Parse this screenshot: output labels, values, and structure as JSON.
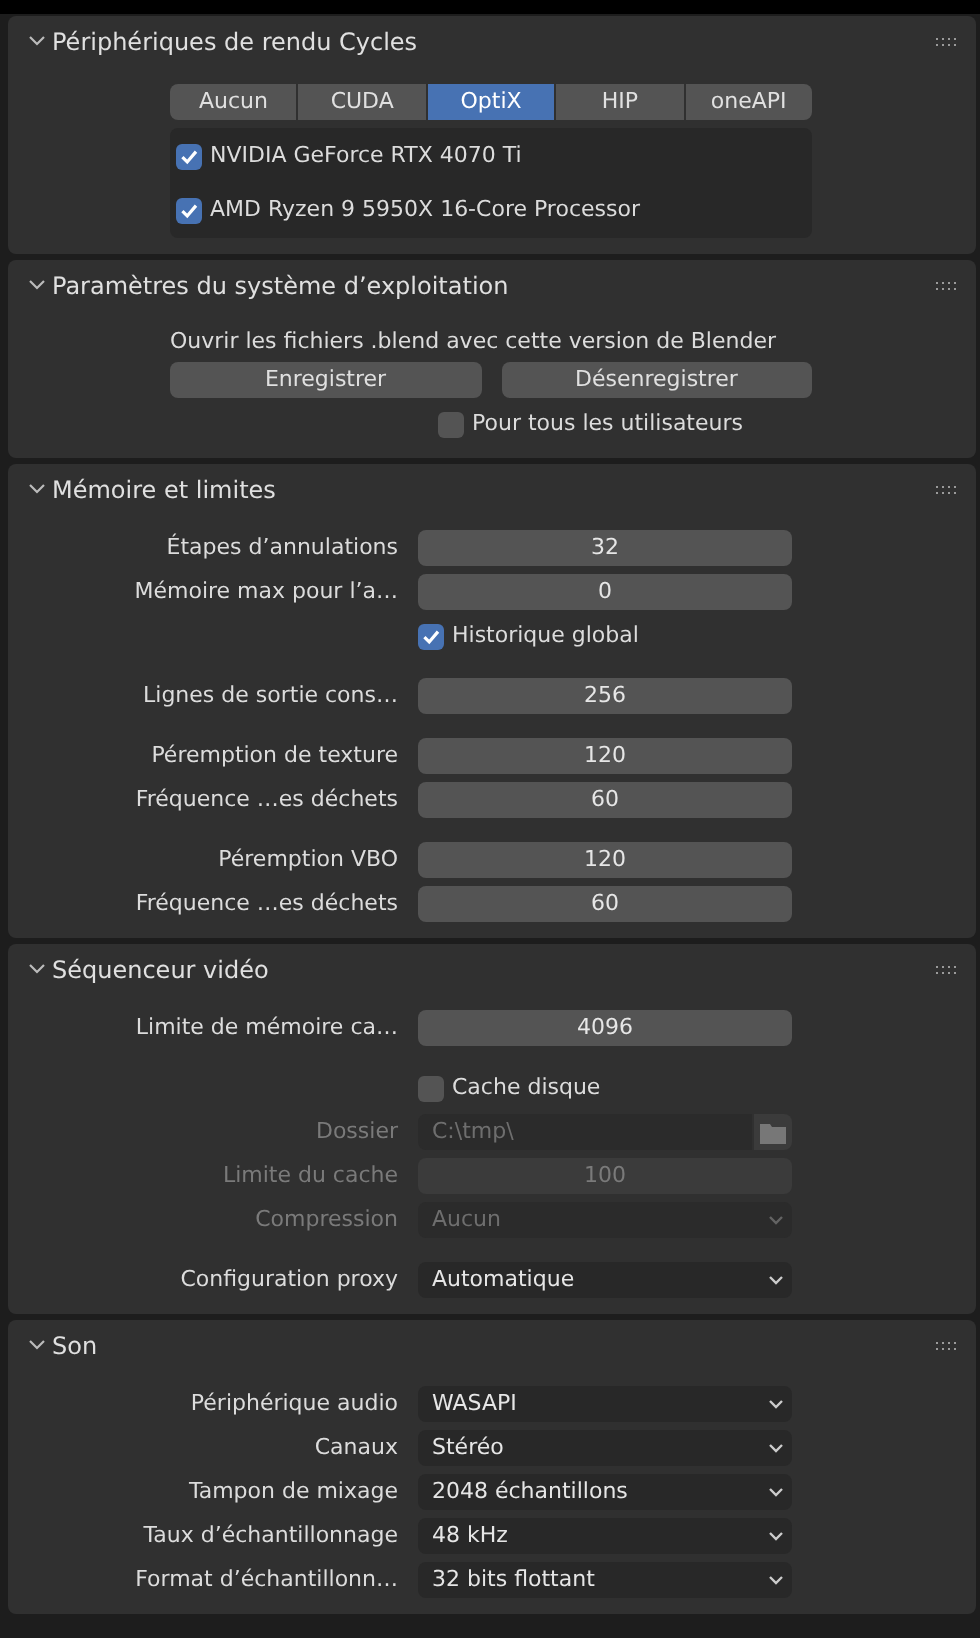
{
  "panels": [
    {
      "title": "Périphériques de rendu Cycles",
      "expanded": true,
      "kind": "devices",
      "tabs": [
        {
          "label": "Aucun",
          "selected": false
        },
        {
          "label": "CUDA",
          "selected": false
        },
        {
          "label": "OptiX",
          "selected": true
        },
        {
          "label": "HIP",
          "selected": false
        },
        {
          "label": "oneAPI",
          "selected": false
        }
      ],
      "devices": [
        {
          "label": "NVIDIA GeForce RTX 4070 Ti",
          "checked": true
        },
        {
          "label": "AMD Ryzen 9 5950X 16-Core Processor",
          "checked": true
        }
      ]
    },
    {
      "title": "Paramètres du système d’exploitation",
      "expanded": true,
      "kind": "system",
      "text": "Ouvrir les fichiers .blend avec cette version de Blender",
      "buttons": [
        "Enregistrer",
        "Désenregistrer"
      ],
      "checkbox": {
        "label": "Pour tous les utilisateurs",
        "checked": false
      }
    },
    {
      "title": "Mémoire et limites",
      "expanded": true,
      "kind": "rows",
      "groups": [
        [
          {
            "kind": "number",
            "label": "Étapes d’annulations",
            "value": "32",
            "disabled": false
          },
          {
            "kind": "number",
            "label": "Mémoire max pour l’a…",
            "value": "0",
            "disabled": false
          },
          {
            "kind": "checkbox",
            "label": "Historique global",
            "checked": true,
            "disabled": false
          }
        ],
        [
          {
            "kind": "number",
            "label": "Lignes de sortie cons…",
            "value": "256",
            "disabled": false
          }
        ],
        [
          {
            "kind": "number",
            "label": "Péremption de texture",
            "value": "120",
            "disabled": false
          },
          {
            "kind": "number",
            "label": "Fréquence …es déchets",
            "value": "60",
            "disabled": false
          }
        ],
        [
          {
            "kind": "number",
            "label": "Péremption VBO",
            "value": "120",
            "disabled": false
          },
          {
            "kind": "number",
            "label": "Fréquence …es déchets",
            "value": "60",
            "disabled": false
          }
        ]
      ]
    },
    {
      "title": "Séquenceur vidéo",
      "expanded": true,
      "kind": "rows",
      "groups": [
        [
          {
            "kind": "number",
            "label": "Limite de mémoire ca…",
            "value": "4096",
            "disabled": false
          }
        ],
        [
          {
            "kind": "checkbox",
            "label": "Cache disque",
            "checked": false,
            "disabled": false
          },
          {
            "kind": "path",
            "label": "Dossier",
            "value": "C:\\tmp\\",
            "disabled": true
          },
          {
            "kind": "number",
            "label": "Limite du cache",
            "value": "100",
            "disabled": true
          },
          {
            "kind": "dropdown",
            "label": "Compression",
            "value": "Aucun",
            "disabled": true
          }
        ],
        [
          {
            "kind": "dropdown",
            "label": "Configuration proxy",
            "value": "Automatique",
            "disabled": false
          }
        ]
      ]
    },
    {
      "title": "Son",
      "expanded": true,
      "kind": "rows",
      "groups": [
        [
          {
            "kind": "dropdown",
            "label": "Périphérique audio",
            "value": "WASAPI",
            "disabled": false
          },
          {
            "kind": "dropdown",
            "label": "Canaux",
            "value": "Stéréo",
            "disabled": false
          },
          {
            "kind": "dropdown",
            "label": "Tampon de mixage",
            "value": "2048 échantillons",
            "disabled": false
          },
          {
            "kind": "dropdown",
            "label": "Taux d’échantillonnage",
            "value": "48 kHz",
            "disabled": false
          },
          {
            "kind": "dropdown",
            "label": "Format d’échantillonn…",
            "value": "32 bits flottant",
            "disabled": false
          }
        ]
      ]
    }
  ]
}
